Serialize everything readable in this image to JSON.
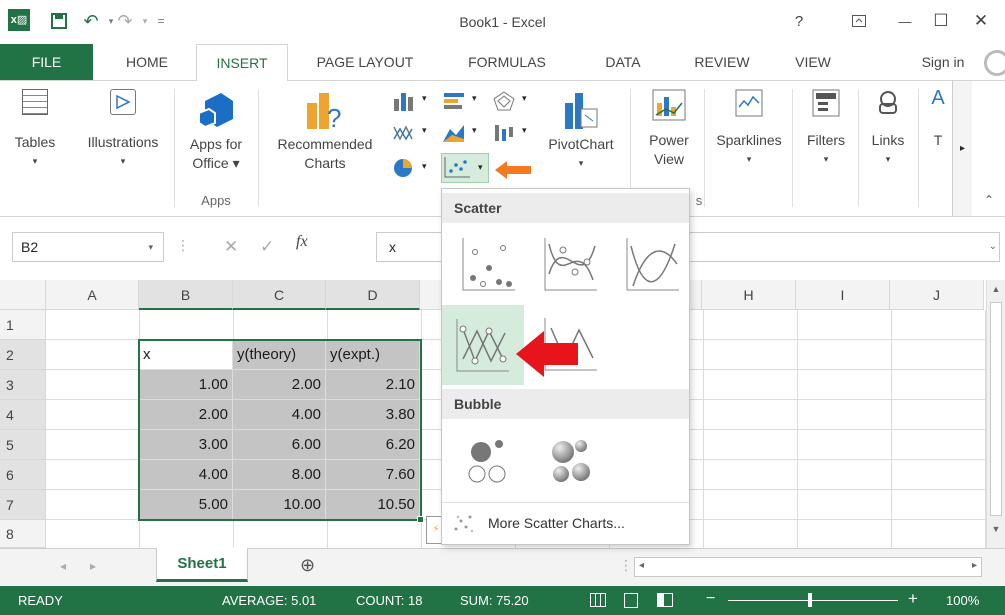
{
  "window": {
    "title": "Book1 - Excel",
    "help": "?",
    "restore_ribbon": "⧈",
    "minimize": "—",
    "maximize": "☐",
    "close": "✕"
  },
  "qat": {
    "app_icon": "excel-logo-icon",
    "save": "save-icon",
    "undo": "undo-icon",
    "redo": "redo-icon",
    "customize": "customize-qat-icon"
  },
  "tabs": [
    {
      "label": "FILE"
    },
    {
      "label": "HOME"
    },
    {
      "label": "INSERT"
    },
    {
      "label": "PAGE LAYOUT"
    },
    {
      "label": "FORMULAS"
    },
    {
      "label": "DATA"
    },
    {
      "label": "REVIEW"
    },
    {
      "label": "VIEW"
    }
  ],
  "sign_in": "Sign in",
  "ribbon": {
    "tables": "Tables",
    "illustrations": "Illustrations",
    "apps_for_office_1": "Apps for",
    "apps_for_office_2": "Office ▾",
    "apps_group": "Apps",
    "recommended_1": "Recommended",
    "recommended_2": "Charts",
    "charts_group": "Cha",
    "pivotchart": "PivotChart",
    "power_view_1": "Power",
    "power_view_2": "View",
    "reports_group": "s",
    "sparklines": "Sparklines",
    "filters": "Filters",
    "links": "Links",
    "text": "T"
  },
  "formula": {
    "name_box": "B2",
    "fx": "fx",
    "content": "x",
    "cancel": "✕",
    "enter": "✓"
  },
  "columns": [
    "A",
    "B",
    "C",
    "D",
    "H",
    "I",
    "J"
  ],
  "rows": [
    "1",
    "2",
    "3",
    "4",
    "5",
    "6",
    "7",
    "8"
  ],
  "table": {
    "headers": [
      "x",
      "y(theory)",
      "y(expt.)"
    ],
    "data": [
      [
        "1.00",
        "2.00",
        "2.10"
      ],
      [
        "2.00",
        "4.00",
        "3.80"
      ],
      [
        "3.00",
        "6.00",
        "6.20"
      ],
      [
        "4.00",
        "8.00",
        "7.60"
      ],
      [
        "5.00",
        "10.00",
        "10.50"
      ]
    ]
  },
  "dropdown": {
    "scatter_title": "Scatter",
    "bubble_title": "Bubble",
    "more": "More Scatter Charts..."
  },
  "sheets": [
    {
      "label": "Sheet1"
    }
  ],
  "add_sheet": "⊕",
  "status": {
    "ready": "READY",
    "average": "AVERAGE: 5.01",
    "count": "COUNT: 18",
    "sum": "SUM: 75.20",
    "zoom": "100%"
  },
  "colors": {
    "excel_green": "#217346",
    "highlight": "#d5ecdc",
    "orange_arrow": "#f47920",
    "red_arrow": "#e8141c",
    "selection": "#c4c4c4"
  }
}
